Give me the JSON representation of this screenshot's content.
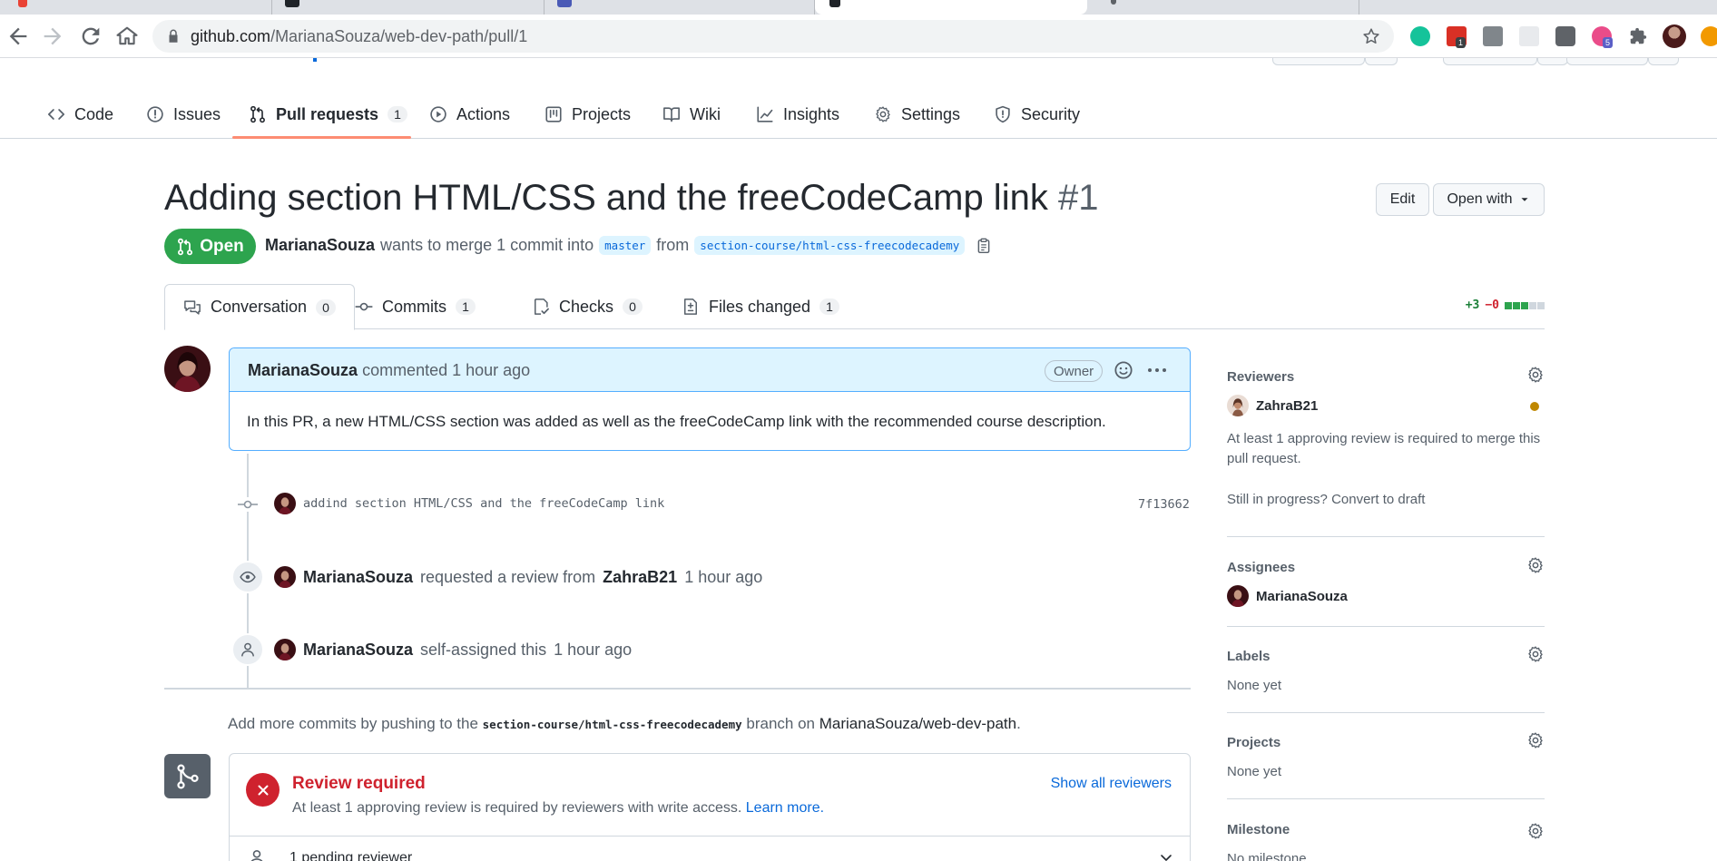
{
  "browser": {
    "url_host": "github.com",
    "url_path": "/MarianaSouza/web-dev-path/pull/1",
    "extension_badges": [
      "1",
      "5"
    ]
  },
  "repo_nav": {
    "items": [
      {
        "label": "Code",
        "icon": "code-icon"
      },
      {
        "label": "Issues",
        "icon": "issue-icon"
      },
      {
        "label": "Pull requests",
        "icon": "pull-request-icon",
        "counter": "1",
        "selected": true
      },
      {
        "label": "Actions",
        "icon": "play-icon"
      },
      {
        "label": "Projects",
        "icon": "project-icon"
      },
      {
        "label": "Wiki",
        "icon": "book-icon"
      },
      {
        "label": "Insights",
        "icon": "graph-icon"
      },
      {
        "label": "Settings",
        "icon": "gear-icon"
      },
      {
        "label": "Security",
        "icon": "shield-icon"
      }
    ]
  },
  "pr": {
    "title": "Adding section HTML/CSS and the freeCodeCamp link",
    "number": "#1",
    "edit_label": "Edit",
    "open_with_label": "Open with",
    "state": "Open",
    "author": "MarianaSouza",
    "meta_text": "wants to merge 1 commit into",
    "base_branch": "master",
    "from_text": "from",
    "head_branch": "section-course/html-css-freecodecademy"
  },
  "tabs": [
    {
      "label": "Conversation",
      "counter": "0",
      "icon": "comment-discussion-icon",
      "selected": true
    },
    {
      "label": "Commits",
      "counter": "1",
      "icon": "git-commit-icon"
    },
    {
      "label": "Checks",
      "counter": "0",
      "icon": "checklist-icon"
    },
    {
      "label": "Files changed",
      "counter": "1",
      "icon": "file-diff-icon"
    }
  ],
  "diffstat": {
    "additions": "+3",
    "deletions": "−0"
  },
  "comment": {
    "author": "MarianaSouza",
    "action": "commented",
    "time": "1 hour ago",
    "role": "Owner",
    "body": "In this PR, a new HTML/CSS section was added as well as the freeCodeCamp link with the recommended course description."
  },
  "timeline": {
    "commit_message": "addind section HTML/CSS and the freeCodeCamp link",
    "commit_sha": "7f13662",
    "review_request": {
      "actor": "MarianaSouza",
      "text": "requested a review from",
      "reviewer": "ZahraB21",
      "time": "1 hour ago"
    },
    "self_assign": {
      "actor": "MarianaSouza",
      "text": "self-assigned this",
      "time": "1 hour ago"
    }
  },
  "push_hint": {
    "prefix": "Add more commits by pushing to the",
    "branch": "section-course/html-css-freecodecademy",
    "middle": "branch on",
    "repo": "MarianaSouza/web-dev-path",
    "suffix": "."
  },
  "merge": {
    "title": "Review required",
    "description": "At least 1 approving review is required by reviewers with write access.",
    "learn_more": "Learn more.",
    "show_all": "Show all reviewers",
    "pending": "1 pending reviewer"
  },
  "sidebar": {
    "reviewers": {
      "heading": "Reviewers",
      "person": "ZahraB21",
      "note": "At least 1 approving review is required to merge this",
      "note2": "pull request.",
      "draft_text": "Still in progress?",
      "draft_link": "Convert to draft"
    },
    "assignees": {
      "heading": "Assignees",
      "person": "MarianaSouza"
    },
    "labels": {
      "heading": "Labels",
      "value": "None yet"
    },
    "projects": {
      "heading": "Projects",
      "value": "None yet"
    },
    "milestone": {
      "heading": "Milestone",
      "value": "No milestone"
    }
  },
  "colors": {
    "open_green": "#2da44e",
    "link_blue": "#0969da",
    "danger_red": "#cf222e",
    "nav_underline": "#fd8c73",
    "pending_yellow": "#bf8700"
  }
}
